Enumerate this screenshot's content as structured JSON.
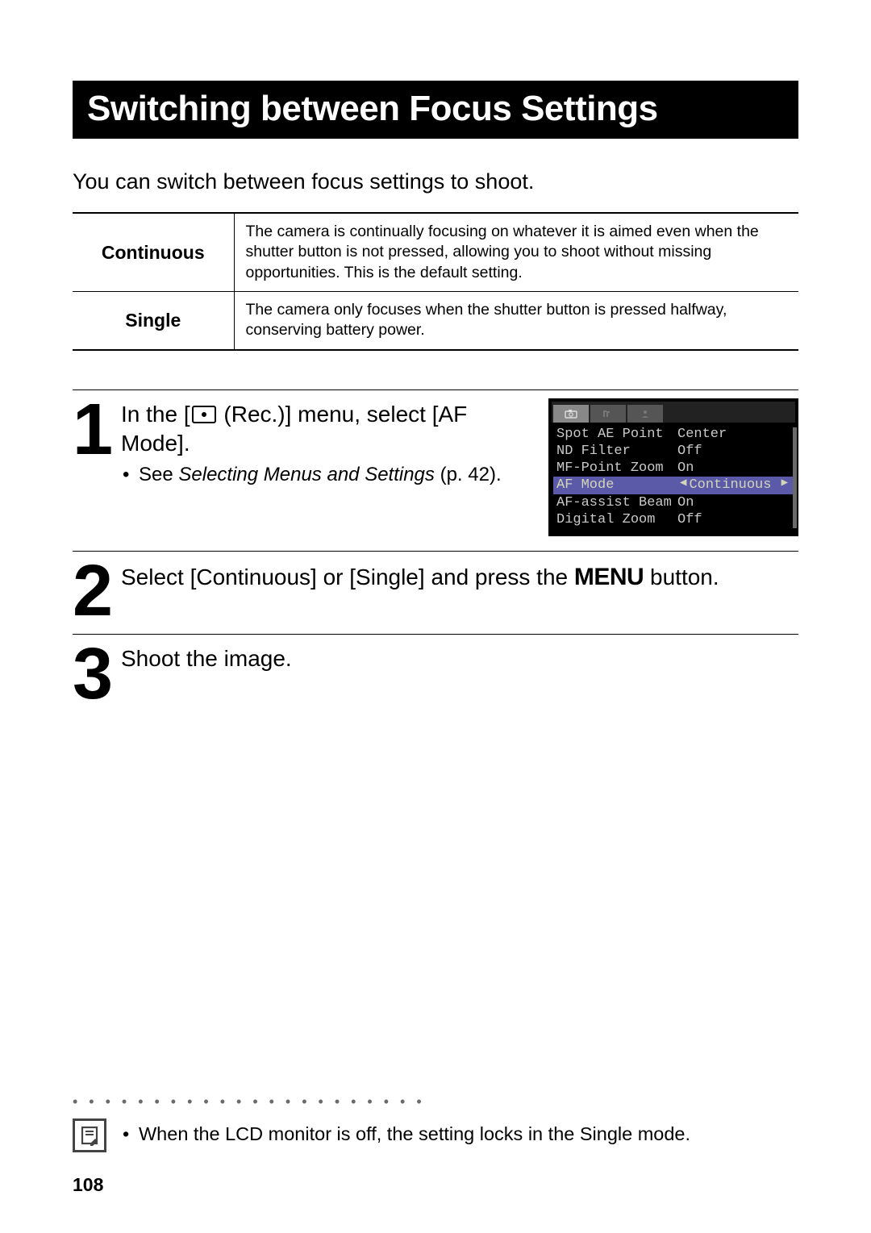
{
  "title": "Switching between Focus Settings",
  "intro": "You can switch between focus settings to shoot.",
  "modes": [
    {
      "name": "Continuous",
      "desc": "The camera is continually focusing on whatever it is aimed even when the shutter button is not pressed, allowing you to shoot without missing opportunities. This is the default setting."
    },
    {
      "name": "Single",
      "desc": "The camera only focuses when the shutter button is pressed halfway, conserving battery power."
    }
  ],
  "steps": {
    "s1": {
      "num": "1",
      "title_pre": "In the [",
      "title_post": " (Rec.)] menu, select [AF Mode].",
      "sub_pre": "See ",
      "sub_italic": "Selecting Menus and Settings",
      "sub_post": " (p. 42)."
    },
    "s2": {
      "num": "2",
      "pre": "Select [Continuous] or [Single] and press the ",
      "menu": "MENU",
      "post": " button."
    },
    "s3": {
      "num": "3",
      "text": "Shoot the image."
    }
  },
  "lcd": {
    "rows": [
      {
        "k": "Spot AE Point",
        "v": "Center"
      },
      {
        "k": "ND Filter",
        "v": "Off"
      },
      {
        "k": "MF-Point Zoom",
        "v": "On"
      },
      {
        "k": "AF Mode",
        "v": "Continuous",
        "hl": true
      },
      {
        "k": "AF-assist Beam",
        "v": "On"
      },
      {
        "k": "Digital Zoom",
        "v": "Off"
      }
    ]
  },
  "note": "When the LCD monitor is off, the setting locks in the Single mode.",
  "page_number": "108"
}
